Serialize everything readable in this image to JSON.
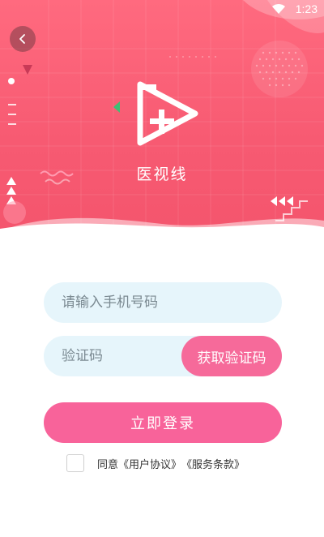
{
  "status_bar": {
    "time": "1:23",
    "wifi_icon": "wifi-icon"
  },
  "header": {
    "back_icon": "chevron-left-icon",
    "app_name": "医视线",
    "logo_icon": "play-plus-logo"
  },
  "form": {
    "phone_placeholder": "请输入手机号码",
    "code_placeholder": "验证码",
    "get_code_label": "获取验证码",
    "login_label": "立即登录"
  },
  "agreement": {
    "prefix": "同意",
    "user_agreement": "《用户协议》",
    "service_terms": "《服务条款》"
  },
  "colors": {
    "hero": "#f75a72",
    "button": "#f8639a",
    "input_bg": "#e6f5fb"
  }
}
